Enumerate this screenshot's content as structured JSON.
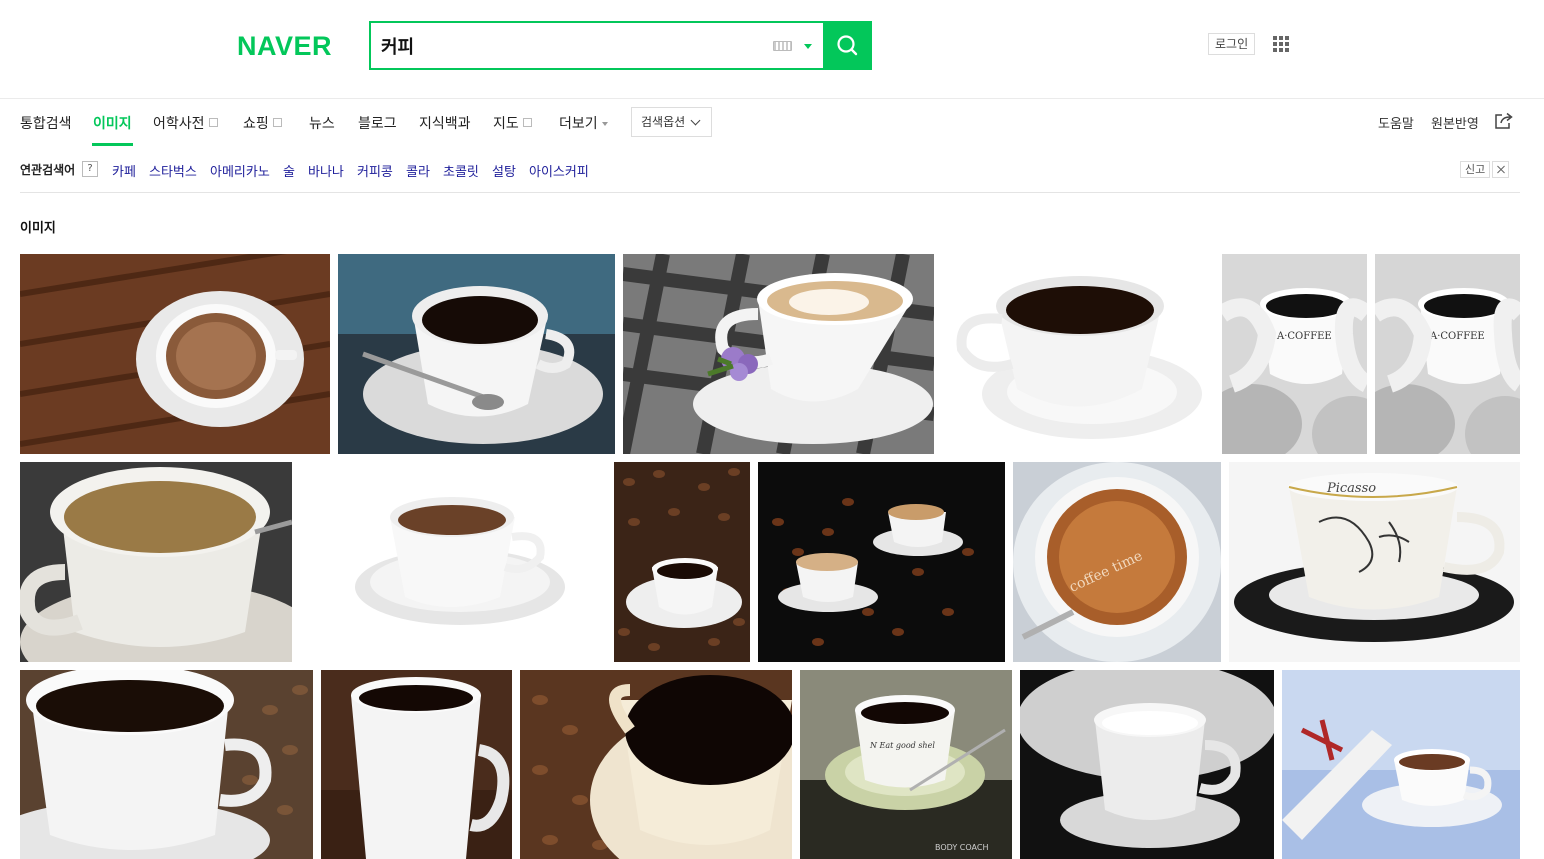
{
  "header": {
    "logo": "NAVER",
    "search_value": "커피",
    "login_label": "로그인"
  },
  "tabs": [
    {
      "label": "통합검색"
    },
    {
      "label": "이미지",
      "active": true
    },
    {
      "label": "어학사전",
      "external": true
    },
    {
      "label": "쇼핑",
      "external": true
    },
    {
      "label": "뉴스"
    },
    {
      "label": "블로그"
    },
    {
      "label": "지식백과"
    },
    {
      "label": "지도",
      "external": true
    },
    {
      "label": "더보기",
      "dropdown": true
    }
  ],
  "search_options_label": "검색옵션",
  "right_links": {
    "help": "도움말",
    "original": "원본반영"
  },
  "related": {
    "title": "연관검색어",
    "help": "?",
    "keywords": [
      "카페",
      "스타벅스",
      "아메리카노",
      "술",
      "바나나",
      "커피콩",
      "콜라",
      "초콜릿",
      "설탕",
      "아이스커피"
    ],
    "report": "신고"
  },
  "section_title": "이미지",
  "images": [
    {
      "subject": "cappuccino cup on wooden table",
      "text": ""
    },
    {
      "subject": "black coffee cup with spoon on blue background",
      "text": ""
    },
    {
      "subject": "latte cup with purple flower on checkered surface",
      "text": ""
    },
    {
      "subject": "white cup of black coffee on white saucer",
      "text": ""
    },
    {
      "subject": "hands holding coffee mug, black and white",
      "text": "A COFFEE"
    },
    {
      "subject": "hands holding coffee mug, black and white",
      "text": "A COFFEE"
    },
    {
      "subject": "cup of milk coffee close-up",
      "text": ""
    },
    {
      "subject": "white espresso cup on white saucer",
      "text": ""
    },
    {
      "subject": "coffee cup on coffee beans",
      "text": ""
    },
    {
      "subject": "two espresso cups with coffee beans on black",
      "text": ""
    },
    {
      "subject": "espresso crema close-up",
      "text": "coffee time"
    },
    {
      "subject": "Picasso cup with black saucer",
      "text": "Picasso"
    },
    {
      "subject": "white cup of black coffee on beans",
      "text": ""
    },
    {
      "subject": "white mug of black coffee on wood",
      "text": ""
    },
    {
      "subject": "cup of black coffee on coffee beans",
      "text": ""
    },
    {
      "subject": "coffee cup with green saucer",
      "text": "BODY COACH"
    },
    {
      "subject": "latte cup black and white",
      "text": ""
    },
    {
      "subject": "tea cup with rolled paper and ribbon",
      "text": ""
    }
  ]
}
